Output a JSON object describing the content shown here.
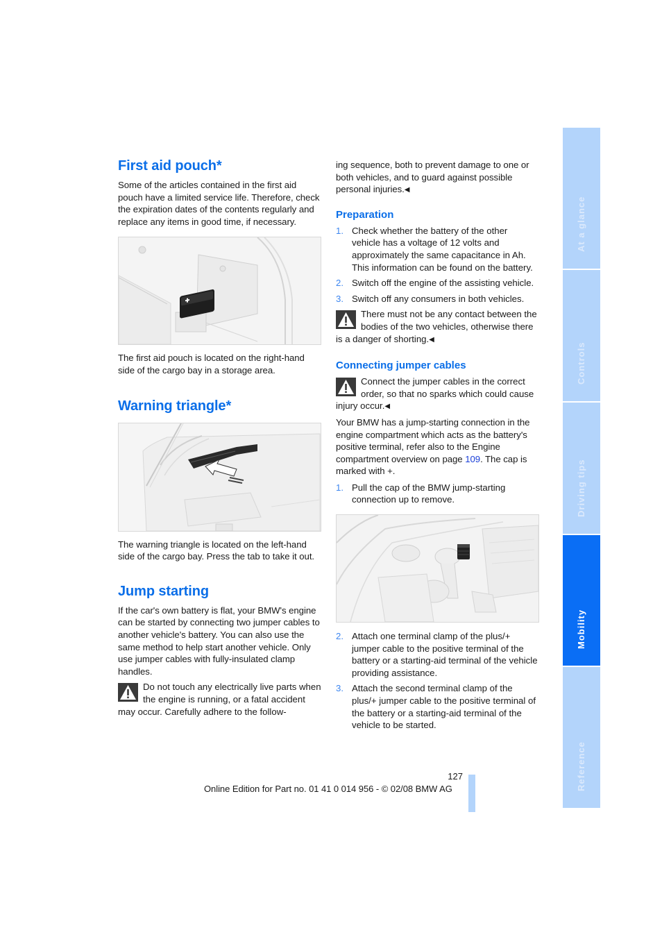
{
  "page": {
    "number": "127",
    "footer": "Online Edition for Part no. 01 41 0 014 956 - © 02/08 BMW AG"
  },
  "colors": {
    "heading": "#0a6ee8",
    "tab_inactive": "#b3d4fb",
    "tab_active": "#0a6ef5",
    "link": "#1a3fd9"
  },
  "side_tabs": [
    {
      "label": "At a glance",
      "active": false
    },
    {
      "label": "Controls",
      "active": false
    },
    {
      "label": "Driving tips",
      "active": false
    },
    {
      "label": "Mobility",
      "active": true
    },
    {
      "label": "Reference",
      "active": false
    }
  ],
  "first_aid": {
    "title": "First aid pouch*",
    "intro": "Some of the articles contained in the first aid pouch have a limited service life. Therefore, check the expiration dates of the contents regularly and replace any items in good time, if necessary.",
    "figure_alt": "First aid pouch in cargo bay storage area",
    "caption": "The first aid pouch is located on the right-hand side of the cargo bay in a storage area."
  },
  "warning_triangle": {
    "title": "Warning triangle*",
    "figure_alt": "Warning triangle on left side of cargo bay with arrow pointing to tab",
    "caption": "The warning triangle is located on the left-hand side of the cargo bay. Press the tab to take it out."
  },
  "jump_starting": {
    "title": "Jump starting",
    "intro": "If the car's own battery is flat, your BMW's engine can be started by connecting two jumper cables to another vehicle's battery. You can also use the same method to help start another vehicle. Only use jumper cables with fully-insulated clamp handles.",
    "warning_1": "Do not touch any electrically live parts when the engine is running, or a fatal accident may occur. Carefully adhere to the following sequence, both to prevent damage to one or both vehicles, and to guard against possible personal injuries.",
    "warning_1_left": "Do not touch any electrically live parts when the engine is running, or a fatal accident may occur. Carefully adhere to the follow-",
    "warning_1_right": "ing sequence, both to prevent damage to one or both vehicles, and to guard against possible personal injuries.",
    "end_mark": "◀",
    "preparation": {
      "title": "Preparation",
      "steps": [
        {
          "num": "1.",
          "text": "Check whether the battery of the other vehicle has a voltage of 12 volts and approximately the same capacitance in Ah. This information can be found on the battery."
        },
        {
          "num": "2.",
          "text": "Switch off the engine of the assisting vehicle."
        },
        {
          "num": "3.",
          "text": "Switch off any consumers in both vehicles."
        }
      ],
      "warning": "There must not be any contact between the bodies of the two vehicles, otherwise there is a danger of shorting."
    },
    "connecting": {
      "title": "Connecting jumper cables",
      "warning": "Connect the jumper cables in the correct order, so that no sparks which could cause injury occur.",
      "body_before_link": "Your BMW has a jump-starting connection in the engine compartment which acts as the battery's positive terminal, refer also to the Engine compartment overview on page ",
      "link_page": "109",
      "body_after_link": ". The cap is marked with +.",
      "steps_a": [
        {
          "num": "1.",
          "text": "Pull the cap of the BMW jump-starting connection up to remove."
        }
      ],
      "figure_alt": "Engine compartment with jump-starting connection cap",
      "steps_b": [
        {
          "num": "2.",
          "text": "Attach one terminal clamp of the plus/+ jumper cable to the positive terminal of the battery or a starting-aid terminal of the vehicle providing assistance."
        },
        {
          "num": "3.",
          "text": "Attach the second terminal clamp of the plus/+ jumper cable to the positive terminal of the battery or a starting-aid terminal of the vehicle to be started."
        }
      ]
    }
  }
}
